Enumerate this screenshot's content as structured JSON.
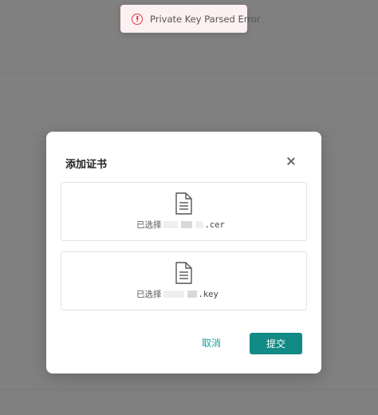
{
  "toast": {
    "icon": "error-circle-icon",
    "message": "Private Key Parsed Error"
  },
  "modal": {
    "title": "添加证书",
    "close_icon": "close-icon",
    "uploads": [
      {
        "icon": "file-icon",
        "prefix": "已选择",
        "extension": ".cer"
      },
      {
        "icon": "file-icon",
        "prefix": "已选择",
        "extension": ".key"
      }
    ],
    "cancel_label": "取消",
    "submit_label": "提交"
  },
  "colors": {
    "accent": "#128a86",
    "link": "#15a39a",
    "error": "#e8334a",
    "overlay": "#808080"
  }
}
